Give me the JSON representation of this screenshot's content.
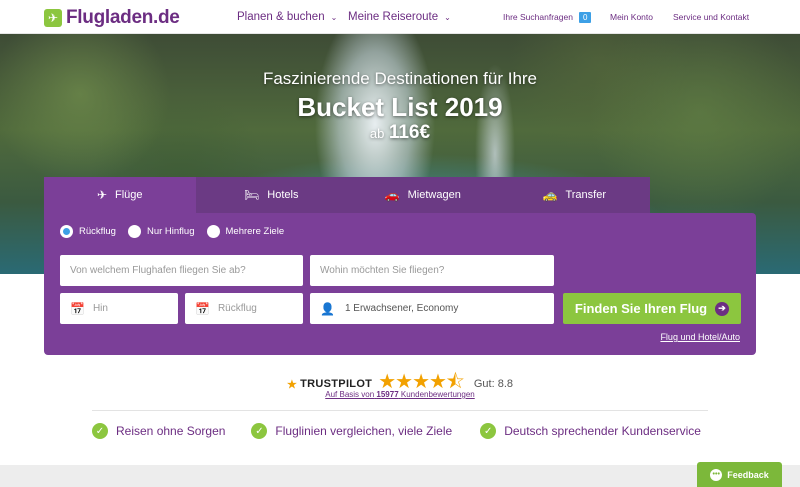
{
  "header": {
    "logo_text": "Flugladen.de",
    "nav": [
      {
        "label": "Planen & buchen"
      },
      {
        "label": "Meine Reiseroute"
      }
    ],
    "search_requests_label": "Ihre Suchanfragen",
    "search_requests_count": "0",
    "account_label": "Mein Konto",
    "service_label": "Service und Kontakt"
  },
  "hero": {
    "line1": "Faszinierende Destinationen für Ihre",
    "line2": "Bucket List 2019",
    "prefix": "ab",
    "price": "116€"
  },
  "tabs": [
    {
      "label": "Flüge",
      "icon": "plane-icon",
      "active": true
    },
    {
      "label": "Hotels",
      "icon": "bed-icon",
      "active": false
    },
    {
      "label": "Mietwagen",
      "icon": "car-icon",
      "active": false
    },
    {
      "label": "Transfer",
      "icon": "taxi-icon",
      "active": false
    }
  ],
  "search": {
    "trip_types": [
      {
        "label": "Rückflug",
        "selected": true
      },
      {
        "label": "Nur Hinflug",
        "selected": false
      },
      {
        "label": "Mehrere Ziele",
        "selected": false
      }
    ],
    "from_placeholder": "Von welchem Flughafen fliegen Sie ab?",
    "to_placeholder": "Wohin möchten Sie fliegen?",
    "depart_placeholder": "Hin",
    "return_placeholder": "Rückflug",
    "passengers_value": "1 Erwachsener, Economy",
    "submit_label": "Finden Sie Ihren Flug",
    "alt_link": "Flug und Hotel/Auto"
  },
  "trustpilot": {
    "brand": "TRUSTPILOT",
    "stars": 4.5,
    "rating_label": "Gut: 8.8",
    "sub_prefix": "Auf Basis von",
    "review_count": "15977",
    "sub_suffix": "Kundenbewertungen"
  },
  "usps": [
    {
      "label": "Reisen ohne Sorgen"
    },
    {
      "label": "Fluglinien vergleichen, viele Ziele"
    },
    {
      "label": "Deutsch sprechender Kundenservice"
    }
  ],
  "feedback_label": "Feedback",
  "colors": {
    "brand_purple": "#6c2d82",
    "panel_purple": "#7b3f98",
    "brand_green": "#8cc63f",
    "accent_blue": "#3da0e6",
    "star_orange": "#f2a100"
  }
}
